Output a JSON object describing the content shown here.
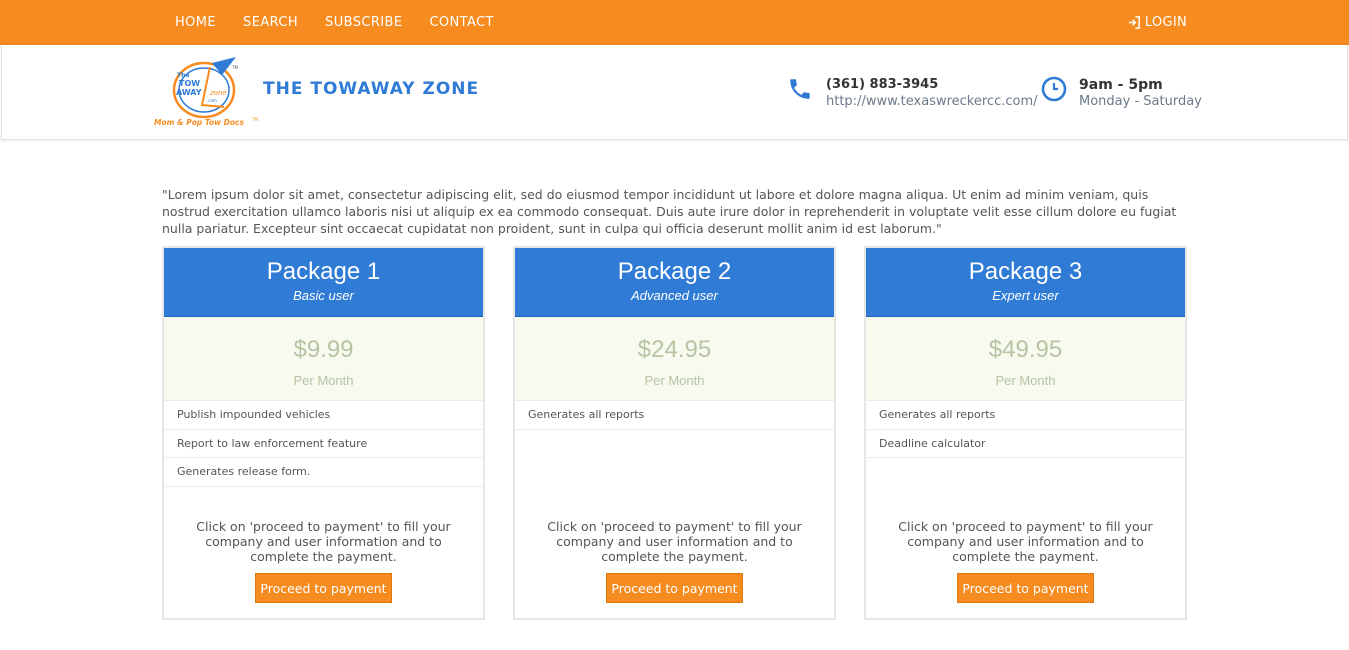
{
  "nav": {
    "items": [
      "HOME",
      "SEARCH",
      "SUBSCRIBE",
      "CONTACT"
    ],
    "login": "LOGIN"
  },
  "header": {
    "brand": "THE TOWAWAY ZONE",
    "logo_lines": [
      "The",
      "TOW",
      "AWAY",
      "zone",
      ".com"
    ],
    "logo_tagline": "Mom & Pop Tow Docs",
    "logo_tm": "TM",
    "phone": "(361) 883-3945",
    "url": "http://www.texaswreckercc.com/",
    "hours": "9am - 5pm",
    "days": "Monday - Saturday"
  },
  "intro": "\"Lorem ipsum dolor sit amet, consectetur adipiscing elit, sed do eiusmod tempor incididunt ut labore et dolore magna aliqua. Ut enim ad minim veniam, quis nostrud exercitation ullamco laboris nisi ut aliquip ex ea commodo consequat. Duis aute irure dolor in reprehenderit in voluptate velit esse cillum dolore eu fugiat nulla pariatur. Excepteur sint occaecat cupidatat non proident, sunt in culpa qui officia deserunt mollit anim id est laborum.\"",
  "packages": [
    {
      "name": "Package 1",
      "tier": "Basic user",
      "price": "$9.99",
      "period": "Per Month",
      "features": [
        "Publish impounded vehicles",
        "Report to law enforcement feature",
        "Generates release form."
      ],
      "description": "Click on 'proceed to payment' to fill your company and user information and to complete the payment.",
      "button": "Proceed to payment"
    },
    {
      "name": "Package 2",
      "tier": "Advanced user",
      "price": "$24.95",
      "period": "Per Month",
      "features": [
        "Generates all reports"
      ],
      "description": "Click on 'proceed to payment' to fill your company and user information and to complete the payment.",
      "button": "Proceed to payment"
    },
    {
      "name": "Package 3",
      "tier": "Expert user",
      "price": "$49.95",
      "period": "Per Month",
      "features": [
        "Generates all reports",
        "Deadline calculator"
      ],
      "description": "Click on 'proceed to payment' to fill your company and user information and to complete the payment.",
      "button": "Proceed to payment"
    }
  ],
  "colors": {
    "accent_orange": "#f68b1f",
    "accent_blue": "#2f7bd6",
    "price_bg": "#f7fbef",
    "price_text": "#b9c2a3"
  }
}
